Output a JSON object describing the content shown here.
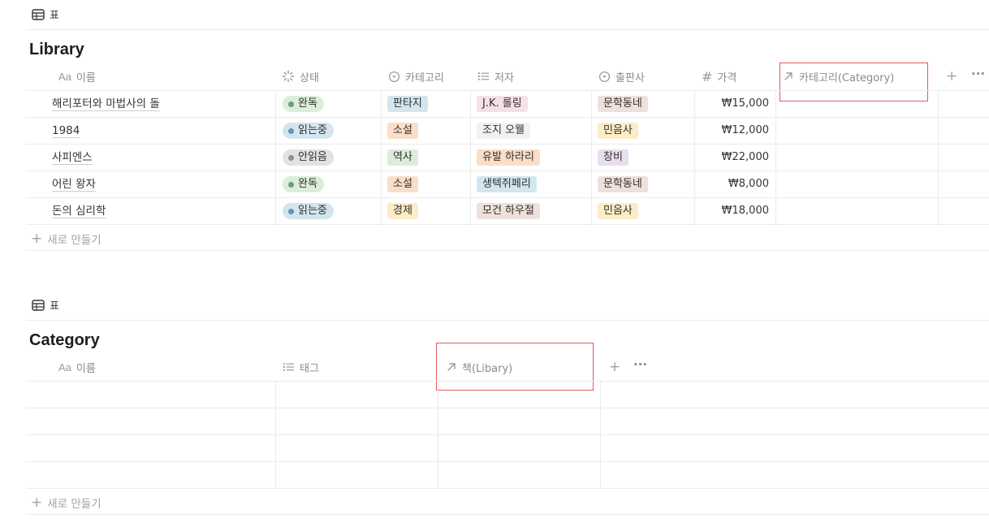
{
  "library": {
    "view_label": "표",
    "title": "Library",
    "columns": {
      "name": "이름",
      "name_icon": "Aa",
      "status": "상태",
      "category": "카테고리",
      "author": "저자",
      "publisher": "출판사",
      "price": "가격",
      "price_icon": "#",
      "relation": "카테고리(Category)"
    },
    "rows": [
      {
        "name": "해리포터와 마법사의 돌",
        "status": "완독",
        "category": "판타지",
        "author": "J.K. 롤링",
        "publisher": "문학동네",
        "price": "₩15,000"
      },
      {
        "name": "1984",
        "status": "읽는중",
        "category": "소설",
        "author": "조지 오웰",
        "publisher": "민음사",
        "price": "₩12,000"
      },
      {
        "name": "사피엔스",
        "status": "안읽음",
        "category": "역사",
        "author": "유발 하라리",
        "publisher": "창비",
        "price": "₩22,000"
      },
      {
        "name": "어린 왕자",
        "status": "완독",
        "category": "소설",
        "author": "생텍쥐페리",
        "publisher": "문학동네",
        "price": "₩8,000"
      },
      {
        "name": "돈의 심리학",
        "status": "읽는중",
        "category": "경제",
        "author": "모건 하우절",
        "publisher": "민음사",
        "price": "₩18,000"
      }
    ],
    "new_label": "새로 만들기"
  },
  "category": {
    "view_label": "표",
    "title": "Category",
    "columns": {
      "name": "이름",
      "name_icon": "Aa",
      "tags": "태그",
      "relation": "책(Libary)"
    },
    "new_label": "새로 만들기"
  },
  "icons": [
    "table-icon",
    "status-icon",
    "select-icon",
    "multi-select-icon",
    "number-icon",
    "relation-icon",
    "plus-icon",
    "more-icon"
  ],
  "colors": {
    "status_done_bg": "#dbeddb",
    "status_done_dot": "#6c9b7d",
    "status_reading_bg": "#d3e5ef",
    "status_reading_dot": "#5b97bd",
    "status_unread_bg": "#e3e2e0",
    "status_unread_dot": "#91918e",
    "tag_blue": "#d3e5ef",
    "tag_orange": "#fadec9",
    "tag_green": "#dbeddb",
    "tag_pink": "#f5e0e9",
    "tag_gray": "#f1f1ef",
    "tag_brown": "#eee0da",
    "tag_yellow": "#fdecc8",
    "tag_purple": "#e8deee",
    "highlight_box": "#e25b5b"
  }
}
